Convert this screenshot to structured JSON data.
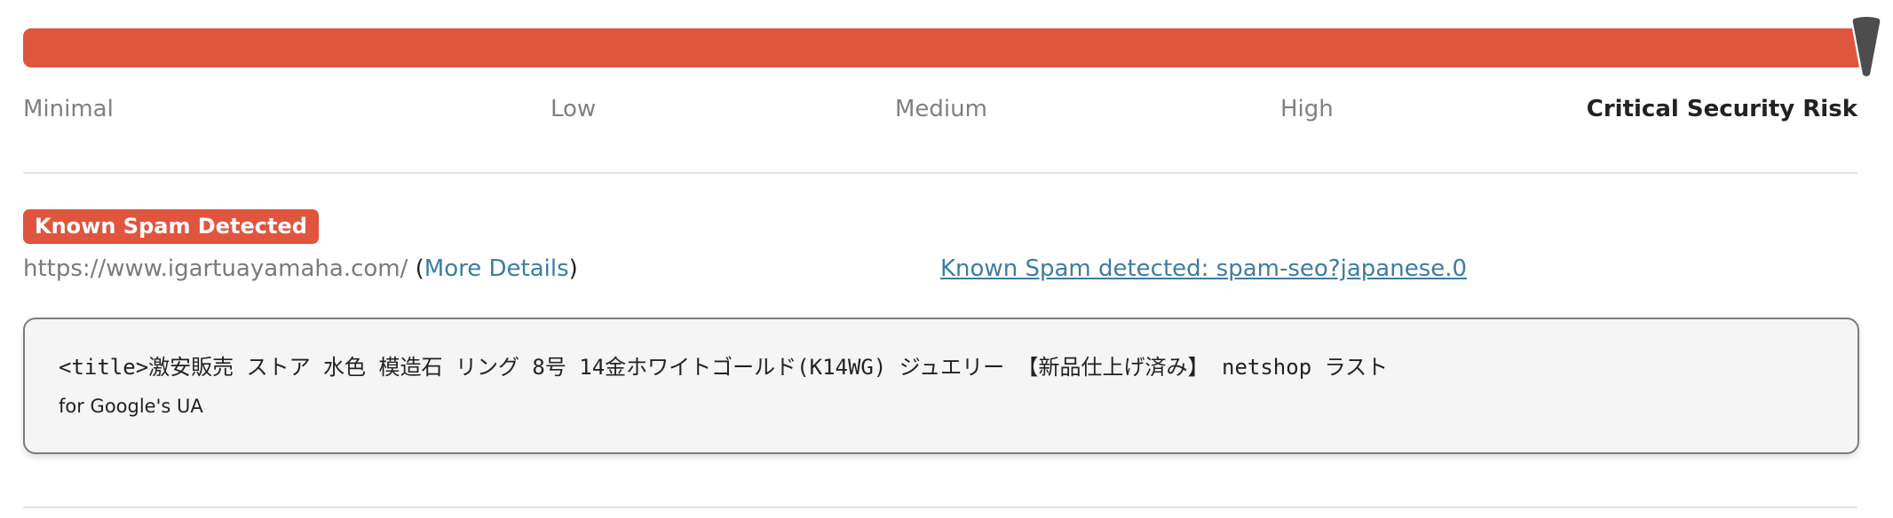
{
  "risk_meter": {
    "level_fraction": 1.0,
    "bar_color": "#E0553D",
    "needle_color": "#4D4D4D",
    "labels": [
      "Minimal",
      "Low",
      "Medium",
      "High",
      "Critical Security Risk"
    ],
    "active_label": "Critical Security Risk"
  },
  "finding": {
    "badge_label": "Known Spam Detected",
    "badge_color": "#E0553D",
    "url": "https://www.igartuayamaha.com/",
    "open_paren": "(",
    "more_details_label": "More Details",
    "close_paren": ")",
    "spam_link_label": "Known Spam detected: spam-seo?japanese.0",
    "code_snippet": "<title>激安販売 ストア 水色 模造石 リング 8号 14金ホワイトゴールド(K14WG) ジュエリー 【新品仕上げ済み】 netshop ラスト",
    "code_note": "for Google's UA"
  }
}
